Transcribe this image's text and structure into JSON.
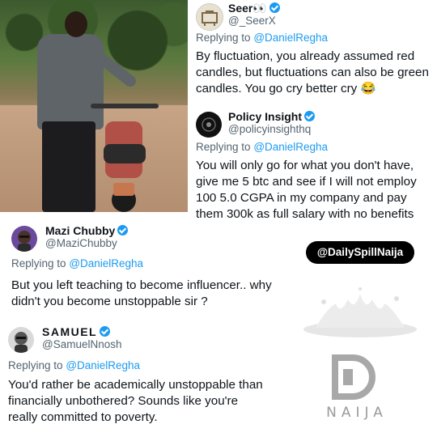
{
  "tweets": [
    {
      "name": "Seer",
      "name_suffix": "👀",
      "handle": "@_SeerX",
      "reply_prefix": "Replying to",
      "reply_to": "@DanielRegha",
      "body": "By fluctuation, you already assumed red candles, but fluctuations can also be green candles. You go cry better cry 😂"
    },
    {
      "name": "Policy Insight",
      "handle": "@policyinsighthq",
      "reply_prefix": "Replying to",
      "reply_to": "@DanielRegha",
      "body": "You will only go for what you don't have, give me 5 btc and see if I will not employ 100 5.0 CGPA in my company and pay them 300k as full salary with no benefits"
    },
    {
      "name": "Mazi Chubby",
      "handle": "@MaziChubby",
      "reply_prefix": "Replying to",
      "reply_to": "@DanielRegha",
      "body": "But you left teaching to become influencer.. why didn't you become unstoppable sir ?"
    },
    {
      "name": "SAMUEL",
      "handle": "@SamuelNnosh",
      "reply_prefix": "Replying to",
      "reply_to": "@DanielRegha",
      "body": "You'd rather be academically unstoppable than financially unbothered? Sounds like you're really committed to poverty."
    }
  ],
  "watermark": {
    "badge": "@DailySpillNaija",
    "logo_text": "NAIJA"
  },
  "colors": {
    "accent": "#1d9bf0",
    "secondary_text": "#536471",
    "primary_text": "#0f1419"
  }
}
